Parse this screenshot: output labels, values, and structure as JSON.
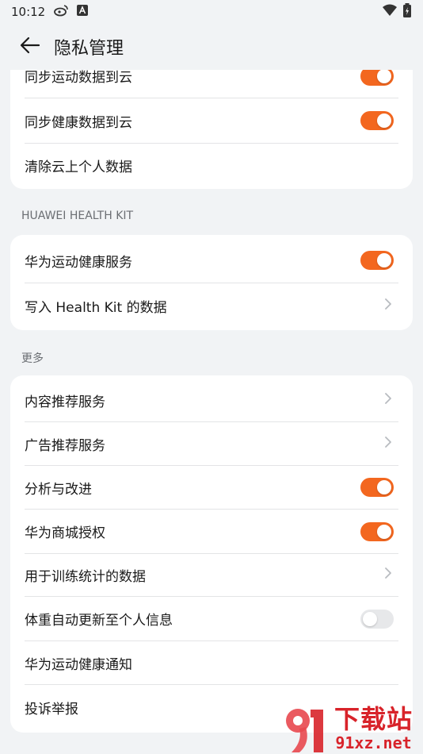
{
  "status_bar": {
    "time": "10:12",
    "icons": [
      "weibo-icon",
      "a-badge-icon",
      "wifi-icon",
      "battery-icon"
    ]
  },
  "header": {
    "title": "隐私管理",
    "back_icon": "arrow-left-icon"
  },
  "cloud_card": {
    "items": [
      {
        "label": "同步运动数据到云",
        "control": "toggle",
        "on": true
      },
      {
        "label": "同步健康数据到云",
        "control": "toggle",
        "on": true
      },
      {
        "label": "清除云上个人数据",
        "control": "none"
      }
    ]
  },
  "health_kit": {
    "heading": "HUAWEI HEALTH KIT",
    "items": [
      {
        "label": "华为运动健康服务",
        "control": "toggle",
        "on": true
      },
      {
        "label": "写入 Health Kit 的数据",
        "control": "chevron"
      }
    ]
  },
  "more": {
    "heading": "更多",
    "items": [
      {
        "label": "内容推荐服务",
        "control": "chevron"
      },
      {
        "label": "广告推荐服务",
        "control": "chevron"
      },
      {
        "label": "分析与改进",
        "control": "toggle",
        "on": true
      },
      {
        "label": "华为商城授权",
        "control": "toggle",
        "on": true
      },
      {
        "label": "用于训练统计的数据",
        "control": "chevron"
      },
      {
        "label": "体重自动更新至个人信息",
        "control": "toggle",
        "on": false
      },
      {
        "label": "华为运动健康通知",
        "control": "none"
      },
      {
        "label": "投诉举报",
        "control": "none"
      }
    ]
  },
  "watermark": {
    "big": "下载站",
    "small": "91xz.net"
  },
  "colors": {
    "accent": "#f3671f",
    "background": "#f1f3f5",
    "card": "#ffffff"
  }
}
